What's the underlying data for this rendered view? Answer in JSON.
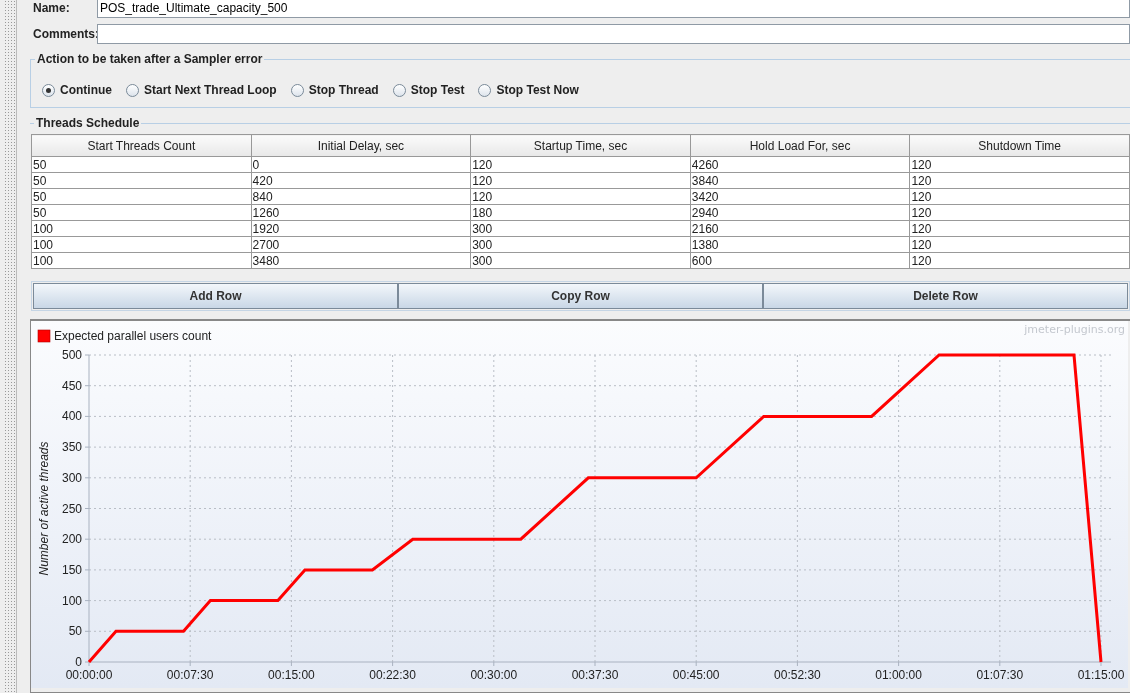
{
  "form": {
    "name_label": "Name:",
    "name_value": "POS_trade_Ultimate_capacity_500",
    "comments_label": "Comments:"
  },
  "sampler_error": {
    "title": "Action to be taken after a Sampler error",
    "options": [
      {
        "label": "Continue",
        "selected": true
      },
      {
        "label": "Start Next Thread Loop",
        "selected": false
      },
      {
        "label": "Stop Thread",
        "selected": false
      },
      {
        "label": "Stop Test",
        "selected": false
      },
      {
        "label": "Stop Test Now",
        "selected": false
      }
    ]
  },
  "threads_schedule": {
    "title": "Threads Schedule",
    "columns": [
      "Start Threads Count",
      "Initial Delay, sec",
      "Startup Time, sec",
      "Hold Load For, sec",
      "Shutdown Time"
    ],
    "rows": [
      [
        "50",
        "0",
        "120",
        "4260",
        "120"
      ],
      [
        "50",
        "420",
        "120",
        "3840",
        "120"
      ],
      [
        "50",
        "840",
        "120",
        "3420",
        "120"
      ],
      [
        "50",
        "1260",
        "180",
        "2940",
        "120"
      ],
      [
        "100",
        "1920",
        "300",
        "2160",
        "120"
      ],
      [
        "100",
        "2700",
        "300",
        "1380",
        "120"
      ],
      [
        "100",
        "3480",
        "300",
        "600",
        "120"
      ]
    ]
  },
  "buttons": [
    "Add Row",
    "Copy Row",
    "Delete Row"
  ],
  "chart": {
    "watermark": "jmeter-plugins.org",
    "chart_data": {
      "type": "line",
      "grid": true,
      "ylabel": "Number of active threads",
      "x": [
        0,
        120,
        420,
        540,
        840,
        960,
        1260,
        1440,
        1920,
        2220,
        2700,
        3000,
        3480,
        3780,
        4380,
        4500
      ],
      "series": [
        {
          "name": "Expected parallel users count",
          "color": "#ff0000",
          "values": [
            0,
            50,
            50,
            100,
            100,
            150,
            150,
            200,
            200,
            300,
            300,
            400,
            400,
            500,
            500,
            0
          ]
        }
      ],
      "xlim": [
        0,
        4500
      ],
      "ylim": [
        0,
        500
      ],
      "xticks": [
        {
          "value": 0,
          "label": "00:00:00"
        },
        {
          "value": 450,
          "label": "00:07:30"
        },
        {
          "value": 900,
          "label": "00:15:00"
        },
        {
          "value": 1350,
          "label": "00:22:30"
        },
        {
          "value": 1800,
          "label": "00:30:00"
        },
        {
          "value": 2250,
          "label": "00:37:30"
        },
        {
          "value": 2700,
          "label": "00:45:00"
        },
        {
          "value": 3150,
          "label": "00:52:30"
        },
        {
          "value": 3600,
          "label": "01:00:00"
        },
        {
          "value": 4050,
          "label": "01:07:30"
        },
        {
          "value": 4500,
          "label": "01:15:00"
        }
      ],
      "yticks": [
        0,
        50,
        100,
        150,
        200,
        250,
        300,
        350,
        400,
        450,
        500
      ]
    }
  }
}
